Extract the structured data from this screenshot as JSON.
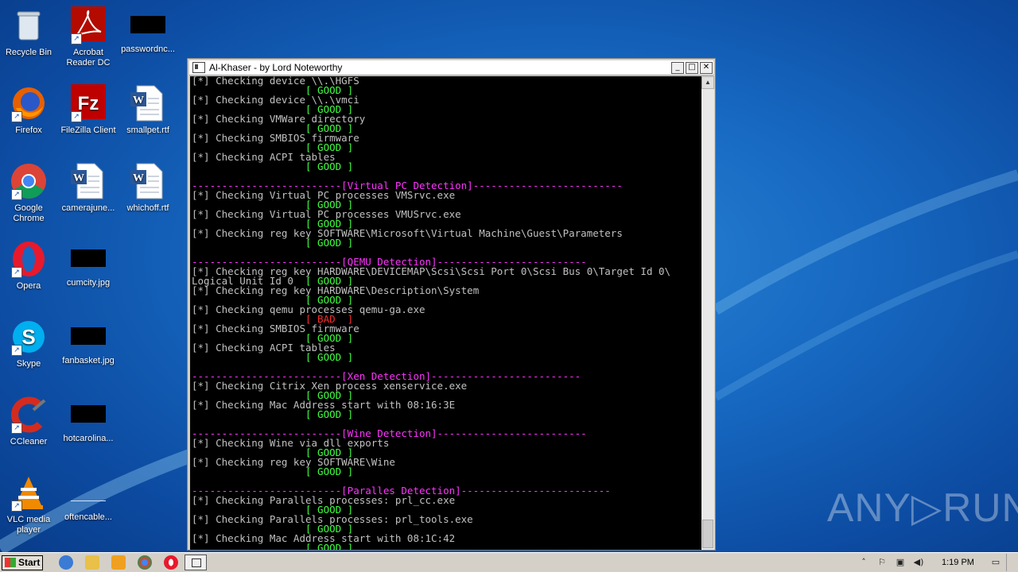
{
  "desktop": {
    "icons": [
      {
        "label": "Recycle Bin"
      },
      {
        "label": "Acrobat Reader DC"
      },
      {
        "label": "passwordnc..."
      },
      {
        "label": "Firefox"
      },
      {
        "label": "FileZilla Client"
      },
      {
        "label": "smallpet.rtf"
      },
      {
        "label": "Google Chrome"
      },
      {
        "label": "camerajune..."
      },
      {
        "label": "whichoff.rtf"
      },
      {
        "label": "Opera"
      },
      {
        "label": "cumcity.jpg"
      },
      {
        "label": "Skype"
      },
      {
        "label": "fanbasket.jpg"
      },
      {
        "label": "CCleaner"
      },
      {
        "label": "hotcarolina..."
      },
      {
        "label": "VLC media player"
      },
      {
        "label": "oftencable..."
      }
    ]
  },
  "window": {
    "title": "Al-Khaser - by Lord Noteworthy",
    "minimize": "_",
    "maximize": "□",
    "close": "✕"
  },
  "console": {
    "lines": [
      {
        "t": "[*] Checking device \\\\.\\HGFS",
        "c": "txt"
      },
      {
        "t": "                   [ GOOD ]",
        "c": "good"
      },
      {
        "t": "[*] Checking device \\\\.\\vmci",
        "c": "txt"
      },
      {
        "t": "                   [ GOOD ]",
        "c": "good"
      },
      {
        "t": "[*] Checking VMWare directory",
        "c": "txt"
      },
      {
        "t": "                   [ GOOD ]",
        "c": "good"
      },
      {
        "t": "[*] Checking SMBIOS firmware",
        "c": "txt"
      },
      {
        "t": "                   [ GOOD ]",
        "c": "good"
      },
      {
        "t": "[*] Checking ACPI tables",
        "c": "txt"
      },
      {
        "t": "                   [ GOOD ]",
        "c": "good"
      },
      {
        "t": "",
        "c": "txt"
      },
      {
        "t": "-------------------------[Virtual PC Detection]-------------------------",
        "c": "sec"
      },
      {
        "t": "[*] Checking Virtual PC processes VMSrvc.exe",
        "c": "txt"
      },
      {
        "t": "                   [ GOOD ]",
        "c": "good"
      },
      {
        "t": "[*] Checking Virtual PC processes VMUSrvc.exe",
        "c": "txt"
      },
      {
        "t": "                   [ GOOD ]",
        "c": "good"
      },
      {
        "t": "[*] Checking reg key SOFTWARE\\Microsoft\\Virtual Machine\\Guest\\Parameters",
        "c": "txt"
      },
      {
        "t": "                   [ GOOD ]",
        "c": "good"
      },
      {
        "t": "",
        "c": "txt"
      },
      {
        "t": "-------------------------[QEMU Detection]-------------------------",
        "c": "sec"
      },
      {
        "t": "[*] Checking reg key HARDWARE\\DEVICEMAP\\Scsi\\Scsi Port 0\\Scsi Bus 0\\Target Id 0\\",
        "c": "txt"
      },
      {
        "t": "Logical Unit Id 0  ",
        "c": "txt",
        "suffix": "[ GOOD ]"
      },
      {
        "t": "[*] Checking reg key HARDWARE\\Description\\System",
        "c": "txt"
      },
      {
        "t": "                   [ GOOD ]",
        "c": "good"
      },
      {
        "t": "[*] Checking qemu processes qemu-ga.exe",
        "c": "txt"
      },
      {
        "t": "                   [ BAD  ]",
        "c": "bad"
      },
      {
        "t": "[*] Checking SMBIOS firmware",
        "c": "txt"
      },
      {
        "t": "                   [ GOOD ]",
        "c": "good"
      },
      {
        "t": "[*] Checking ACPI tables",
        "c": "txt"
      },
      {
        "t": "                   [ GOOD ]",
        "c": "good"
      },
      {
        "t": "",
        "c": "txt"
      },
      {
        "t": "-------------------------[Xen Detection]-------------------------",
        "c": "sec"
      },
      {
        "t": "[*] Checking Citrix Xen process xenservice.exe",
        "c": "txt"
      },
      {
        "t": "                   [ GOOD ]",
        "c": "good"
      },
      {
        "t": "[*] Checking Mac Address start with 08:16:3E",
        "c": "txt"
      },
      {
        "t": "                   [ GOOD ]",
        "c": "good"
      },
      {
        "t": "",
        "c": "txt"
      },
      {
        "t": "-------------------------[Wine Detection]-------------------------",
        "c": "sec"
      },
      {
        "t": "[*] Checking Wine via dll exports",
        "c": "txt"
      },
      {
        "t": "                   [ GOOD ]",
        "c": "good"
      },
      {
        "t": "[*] Checking reg key SOFTWARE\\Wine",
        "c": "txt"
      },
      {
        "t": "                   [ GOOD ]",
        "c": "good"
      },
      {
        "t": "",
        "c": "txt"
      },
      {
        "t": "-------------------------[Paralles Detection]-------------------------",
        "c": "sec"
      },
      {
        "t": "[*] Checking Parallels processes: prl_cc.exe",
        "c": "txt"
      },
      {
        "t": "                   [ GOOD ]",
        "c": "good"
      },
      {
        "t": "[*] Checking Parallels processes: prl_tools.exe",
        "c": "txt"
      },
      {
        "t": "                   [ GOOD ]",
        "c": "good"
      },
      {
        "t": "[*] Checking Mac Address start with 08:1C:42",
        "c": "txt"
      },
      {
        "t": "                   [ GOOD ]",
        "c": "good"
      }
    ]
  },
  "taskbar": {
    "start_label": "Start",
    "clock": "1:19 PM"
  },
  "watermark": "ANY▷RUN",
  "colors": {
    "good": "#3fff3f",
    "bad": "#ff2a2a",
    "section": "#ff33ff",
    "console_text": "#c0c0c0",
    "console_bg": "#000000"
  }
}
